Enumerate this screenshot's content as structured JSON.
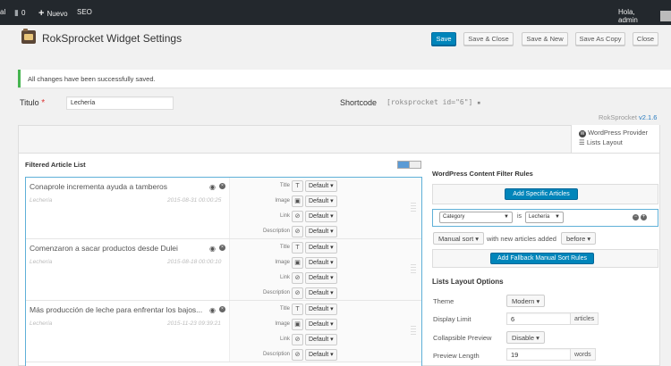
{
  "adminbar": {
    "site": "al",
    "comments": "0",
    "new_label": "Nuevo",
    "seo": "SEO",
    "greeting": "Hola, admin"
  },
  "header": {
    "title": "RokSprocket Widget Settings",
    "save": "Save",
    "save_close": "Save & Close",
    "save_new": "Save & New",
    "save_copy": "Save As Copy",
    "close": "Close"
  },
  "notice": "All changes have been successfully saved.",
  "form": {
    "title_label": "Titulo",
    "required": "*",
    "title_value": "Lechería",
    "shortcode_label": "Shortcode",
    "shortcode_value": "[roksprocket id=\"6\"]"
  },
  "version": {
    "name": "RokSprocket",
    "num": "v2.1.6"
  },
  "provider": {
    "name": "WordPress Provider",
    "layout": "Lists Layout"
  },
  "list": {
    "title": "Filtered Article List",
    "field_labels": [
      "Title",
      "Image",
      "Link",
      "Description"
    ],
    "field_icons": [
      "T",
      "▣",
      "⊘",
      "⊘"
    ],
    "default": "Default",
    "articles": [
      {
        "title": "Conaprole incrementa ayuda a tamberos",
        "category": "Lechería",
        "date": "2015-08-31 00:00:25"
      },
      {
        "title": "Comenzaron a sacar productos desde Dulei",
        "category": "Lechería",
        "date": "2015-08-18 00:00:10"
      },
      {
        "title": "Más producción de leche para enfrentar los bajos...",
        "category": "Lechería",
        "date": "2015-11-23 09:39:21"
      }
    ]
  },
  "filters": {
    "title": "WordPress Content Filter Rules",
    "add_specific": "Add Specific Articles",
    "rule_field": "Category",
    "rule_op": "is",
    "rule_value": "Lechería",
    "sort": "Manual sort",
    "sort_text": "with new articles added",
    "sort_pos": "before",
    "fallback": "Add Fallback Manual Sort Rules"
  },
  "layout_options": {
    "title": "Lists Layout Options",
    "theme_label": "Theme",
    "theme_value": "Modern",
    "limit_label": "Display Limit",
    "limit_value": "6",
    "limit_suffix": "articles",
    "collapse_label": "Collapsible Preview",
    "collapse_value": "Disable",
    "preview_label": "Preview Length",
    "preview_value": "19",
    "preview_suffix": "words"
  }
}
